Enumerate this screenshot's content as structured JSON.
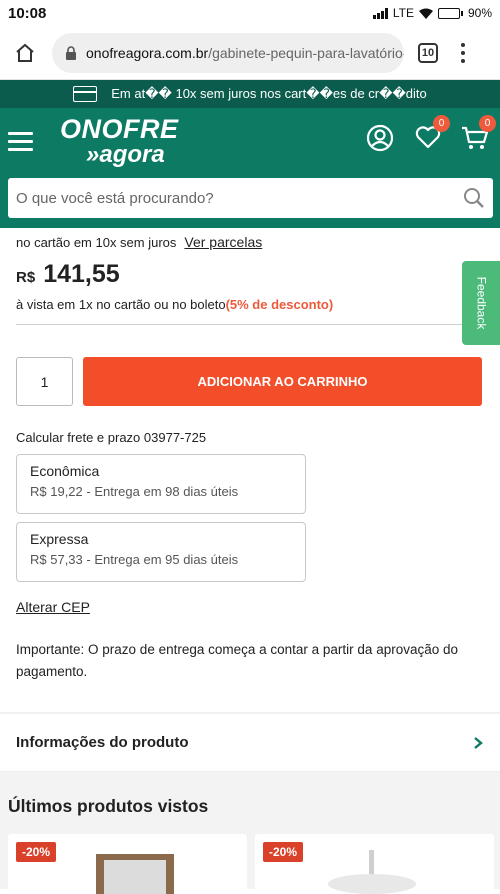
{
  "status_bar": {
    "time": "10:08",
    "network": "LTE",
    "battery_percent": "90%",
    "battery_level": 0.9
  },
  "browser": {
    "url_domain": "onofreagora.com.br",
    "url_path": "/gabinete-pequin-para-lavatório-c",
    "tab_count": "10"
  },
  "promo": {
    "text": "Em at�� 10x sem juros nos cart��es de cr��dito"
  },
  "header": {
    "logo_top": "ONOFRE",
    "logo_bottom": "»agora",
    "wishlist_count": "0",
    "cart_count": "0",
    "brand_color": "#0d7a64",
    "promo_bg": "#0b5c4d"
  },
  "search": {
    "placeholder": "O que você está procurando?"
  },
  "product": {
    "installments_text": "no cartão em 10x sem juros",
    "installments_link": "Ver parcelas",
    "currency": "R$",
    "price": "141,55",
    "cash_text": "à vista em 1x no cartão ou no boleto",
    "discount_text": "(5% de desconto)",
    "quantity": "1",
    "add_to_cart": "ADICIONAR AO CARRINHO",
    "accent_color": "#f24e2a"
  },
  "feedback": {
    "label": "Feedback"
  },
  "shipping": {
    "title": "Calcular frete e prazo 03977-725",
    "options": [
      {
        "name": "Econômica",
        "detail": "R$ 19,22 - Entrega em 98 dias úteis"
      },
      {
        "name": "Expressa",
        "detail": "R$ 57,33 - Entrega em 95 dias úteis"
      }
    ],
    "change_cep": "Alterar CEP",
    "important": "Importante: O prazo de entrega começa a contar a partir da aprovação do pagamento."
  },
  "product_info": {
    "label": "Informações do produto"
  },
  "recent": {
    "title": "Últimos produtos vistos",
    "items": [
      {
        "discount": "-20%"
      },
      {
        "discount": "-20%"
      }
    ]
  }
}
